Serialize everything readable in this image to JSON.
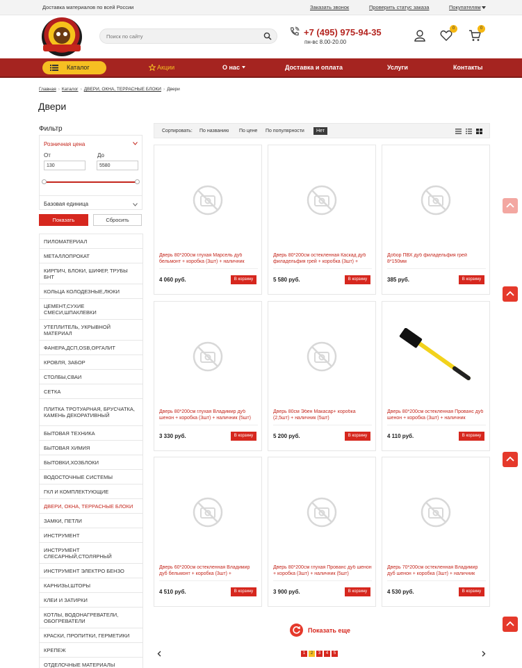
{
  "topbar": {
    "delivery": "Доставка материалов по всей России",
    "callback": "Заказать звонок",
    "order_status": "Проверить статус заказа",
    "buyers": "Покупателям"
  },
  "header": {
    "search_placeholder": "Поиск по сайту",
    "phone": "+7 (495) 975-94-35",
    "hours": "пн-вс 8.00-20.00",
    "wishlist_count": "0",
    "cart_count": "0"
  },
  "nav": {
    "catalog": "Каталог",
    "items": [
      "Акции",
      "О нас",
      "Доставка и оплата",
      "Услуги",
      "Контакты"
    ]
  },
  "breadcrumb": [
    "Главная",
    "Каталог",
    "ДВЕРИ, ОКНА, ТЕРРАСНЫЕ БЛОКИ",
    "Двери"
  ],
  "page_title": "Двери",
  "filter": {
    "title": "Фильтр",
    "price_label": "Розничная цена",
    "from_label": "От",
    "to_label": "До",
    "from_value": "130",
    "to_value": "5580",
    "unit_label": "Базовая единица",
    "show_btn": "Показать",
    "reset_btn": "Сбросить"
  },
  "categories": [
    "ПИЛОМАТЕРИАЛ",
    "МЕТАЛЛОПРОКАТ",
    "КИРПИЧ, БЛОКИ, ШИФЕР, ТРУБЫ БНТ",
    "КОЛЬЦА КОЛОДЕЗНЫЕ,ЛЮКИ",
    "ЦЕМЕНТ,СУХИЕ СМЕСИ,ШПАКЛЕВКИ",
    "УТЕПЛИТЕЛЬ, УКРЫВНОЙ МАТЕРИАЛ",
    "ФАНЕРА,ДСП,OSB,ОРГАЛИТ",
    "КРОВЛЯ, ЗАБОР",
    "СТОЛБЫ,СВАИ",
    "СЕТКА",
    "ПЛИТКА ТРОТУАРНАЯ, БРУСЧАТКА, КАМЕНЬ ДЕКОРАТИВНЫЙ",
    "БЫТОВАЯ ТЕХНИКА",
    "БЫТОВАЯ ХИМИЯ",
    "БЫТОВКИ,ХОЗБЛОКИ",
    "ВОДОСТОЧНЫЕ СИСТЕМЫ",
    "ГКЛ И КОМПЛЕКТУЮЩИЕ",
    "ДВЕРИ, ОКНА, ТЕРРАСНЫЕ БЛОКИ",
    "ЗАМКИ, ПЕТЛИ",
    "ИНСТРУМЕНТ",
    "ИНСТРУМЕНТ СЛЕСАРНЫЙ,СТОЛЯРНЫЙ",
    "ИНСТРУМЕНТ ЭЛЕКТРО БЕНЗО",
    "КАРНИЗЫ,ШТОРЫ",
    "КЛЕИ И ЗАТИРКИ",
    "КОТЛЫ, ВОДОНАГРЕВАТЕЛИ, ОБОГРЕВАТЕЛИ",
    "КРАСКИ, ПРОПИТКИ, ГЕРМЕТИКИ",
    "КРЕПЕЖ",
    "ОТДЕЛОЧНЫЕ МАТЕРИАЛЫ"
  ],
  "sort": {
    "label": "Сортировать:",
    "by_name": "По названию",
    "by_price": "По цене",
    "by_popularity": "По популярности",
    "none": "Нет"
  },
  "products": [
    {
      "name": "Дверь 80*200см глухая Марсель дуб бельмонт + коробка (3шт) + наличник",
      "price": "4 060 руб.",
      "cart": "В корзину",
      "image": "no-photo-icon"
    },
    {
      "name": "Дверь 80*200см остекленная Каскад дуб филадельфия грей + коробка (3шт) +",
      "price": "5 580 руб.",
      "cart": "В корзину",
      "image": "no-photo-icon"
    },
    {
      "name": "Добор ПВХ дуб филадельфия грей 8*150мм",
      "price": "385 руб.",
      "cart": "В корзину",
      "image": "no-photo-icon"
    },
    {
      "name": "Дверь 80*200см глухая Владимир дуб шенон + коробка (3шт) + наличник (5шт)",
      "price": "3 330 руб.",
      "cart": "В корзину",
      "image": "no-photo-icon"
    },
    {
      "name": "Дверь 80см Эбен Макасар+ коробка (2,5шт) + наличник (5шт)",
      "price": "5 200 руб.",
      "cart": "В корзину",
      "image": "no-photo-icon"
    },
    {
      "name": "Дверь 80*200см остекленная Прованс дуб шенон + коробка (3шт) + наличник",
      "price": "4 110 руб.",
      "cart": "В корзину",
      "image": "sledgehammer-image"
    },
    {
      "name": "Дверь 60*200см остекленная Владимир дуб бельмонт + коробка (3шт) +",
      "price": "4 510 руб.",
      "cart": "В корзину",
      "image": "no-photo-icon"
    },
    {
      "name": "Дверь 80*200см глухая Прованс дуб шенон + коробка (3шт) + наличник (5шт)",
      "price": "3 900 руб.",
      "cart": "В корзину",
      "image": "no-photo-icon"
    },
    {
      "name": "Дверь 70*200см остекленная Владимир дуб шенон + коробка (3шт) + наличник",
      "price": "4 530 руб.",
      "cart": "В корзину",
      "image": "no-photo-icon"
    }
  ],
  "show_more": "Показать еще",
  "pagination": [
    "1",
    "2",
    "3",
    "4",
    "5"
  ],
  "colors": {
    "brand_red": "#a52420",
    "accent_red": "#d6271e",
    "accent_yellow": "#f6bf22"
  }
}
